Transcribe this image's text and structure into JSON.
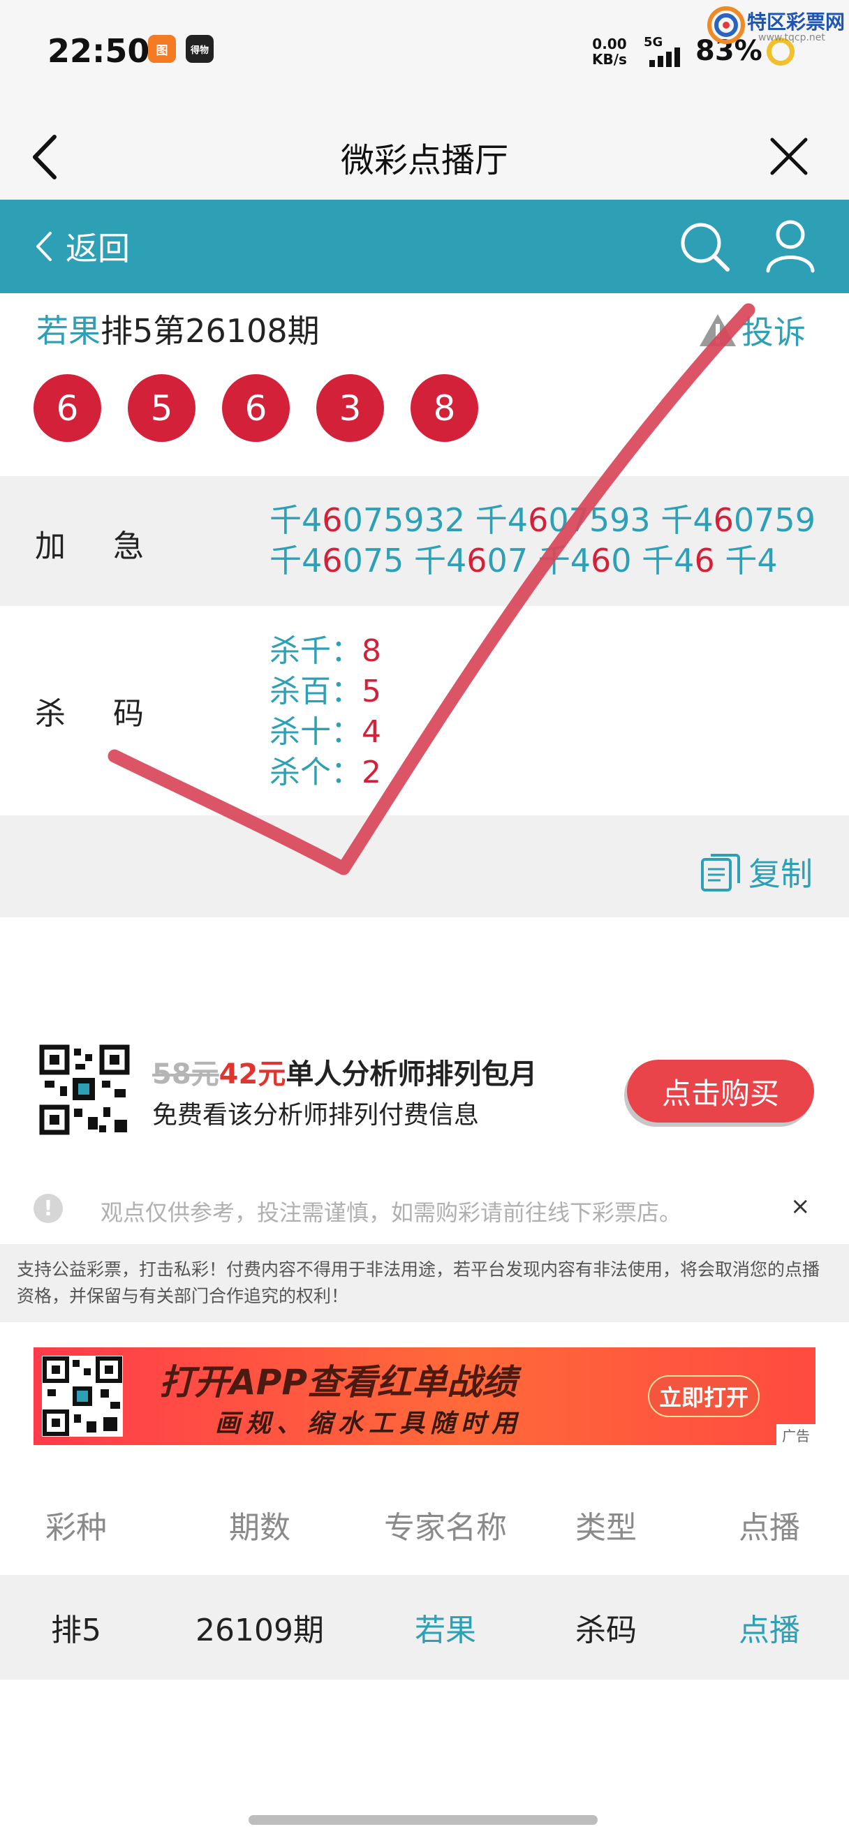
{
  "status_bar": {
    "time": "22:50",
    "app_badge_1": "图",
    "app_badge_2": "得物",
    "net_speed_value": "0.00",
    "net_speed_unit": "KB/s",
    "signal": "5G",
    "battery": "83%"
  },
  "watermark": {
    "text": "特区彩票网",
    "url": "www.tqcp.net"
  },
  "nav": {
    "title": "微彩点播厅"
  },
  "toolbar": {
    "back_label": "返回"
  },
  "issue": {
    "expert": "若果",
    "text": "排5第26108期",
    "complain_label": "投诉"
  },
  "balls": [
    "6",
    "5",
    "6",
    "3",
    "8"
  ],
  "jiaji": {
    "label": "加急",
    "line1": [
      {
        "p": "千4",
        "r": "6",
        "s": "075932 "
      },
      {
        "p": "千4",
        "r": "6",
        "s": "07593 "
      },
      {
        "p": "千4",
        "r": "6",
        "s": "0759"
      }
    ],
    "line2": [
      {
        "p": "千4",
        "r": "6",
        "s": "075 "
      },
      {
        "p": "千4",
        "r": "6",
        "s": "07 "
      },
      {
        "p": "千4",
        "r": "6",
        "s": "0 "
      },
      {
        "p": "千4",
        "r": "6",
        "s": " "
      },
      {
        "p": "千4",
        "r": "",
        "s": ""
      }
    ]
  },
  "shama": {
    "label": "杀码",
    "items": [
      {
        "label": "杀千：",
        "value": "8"
      },
      {
        "label": "杀百：",
        "value": "5"
      },
      {
        "label": "杀十：",
        "value": "4"
      },
      {
        "label": "杀个：",
        "value": "2"
      }
    ]
  },
  "copy": {
    "label": "复制"
  },
  "promo": {
    "old_price": "58元",
    "new_price": "42元",
    "title": "单人分析师排列包月",
    "subtitle": "免费看该分析师排列付费信息",
    "buy_label": "点击购买"
  },
  "disclaimer": {
    "text": "观点仅供参考，投注需谨慎，如需购彩请前往线下彩票店。",
    "close": "×"
  },
  "notice": "支持公益彩票，打击私彩！付费内容不得用于非法用途，若平台发现内容有非法使用，将会取消您的点播资格，并保留与有关部门合作追究的权利！",
  "banner": {
    "line1": "打开APP查看红单战绩",
    "line2": "画规、缩水工具随时用",
    "button": "立即打开",
    "ad_tag": "广告"
  },
  "table": {
    "headers": [
      "彩种",
      "期数",
      "专家名称",
      "类型",
      "点播"
    ],
    "rows": [
      [
        "排5",
        "26109期",
        "若果",
        "杀码",
        "点播"
      ]
    ]
  },
  "colors": {
    "teal": "#2ea0b6",
    "ball_red": "#d3213a",
    "check_red": "#d9475a"
  }
}
